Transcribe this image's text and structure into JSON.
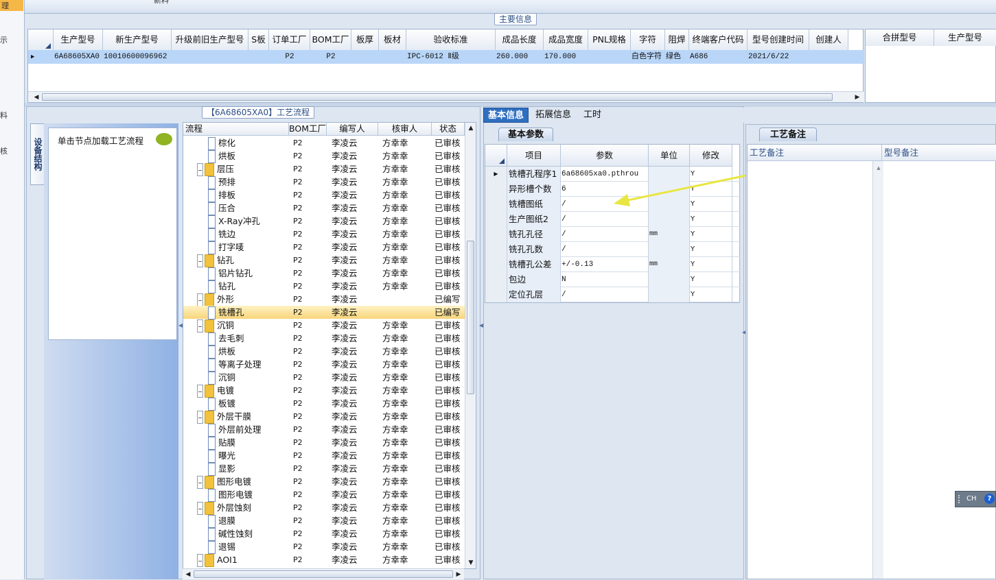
{
  "left_strip": {
    "tab": "理",
    "chars": [
      "示",
      "料",
      "核"
    ]
  },
  "top_tab": "新料",
  "main_info": {
    "title": "主要信息",
    "columns": [
      "生产型号",
      "新生产型号",
      "升级前旧生产型号",
      "S板",
      "订单工厂",
      "BOM工厂",
      "板厚",
      "板材",
      "验收标准",
      "成品长度",
      "成品宽度",
      "PNL规格",
      "字符",
      "阻焊",
      "终端客户代码",
      "型号创建时间",
      "创建人"
    ],
    "row": [
      "6A68605XA0",
      "10010600096962",
      "",
      "",
      "P2",
      "P2",
      "",
      "",
      "IPC-6012 Ⅱ级",
      "260.000",
      "170.000",
      "",
      "白色字符",
      "绿色",
      "A686",
      "2021/6/22",
      ""
    ],
    "right_columns": [
      "合拼型号",
      "生产型号"
    ]
  },
  "flow": {
    "title": "【6A68605XA0】工艺流程",
    "side_tab": "设备结构",
    "nav_text": "单击节点加载工艺流程",
    "columns": [
      "流程",
      "BOM工厂",
      "编写人",
      "核审人",
      "状态"
    ],
    "rows": [
      {
        "level": 2,
        "name": "棕化",
        "bom": "P2",
        "writer": "李凌云",
        "reviewer": "方幸幸",
        "status": "已审核"
      },
      {
        "level": 2,
        "name": "烘板",
        "bom": "P2",
        "writer": "李凌云",
        "reviewer": "方幸幸",
        "status": "已审核"
      },
      {
        "level": 1,
        "name": "层压",
        "bom": "P2",
        "writer": "李凌云",
        "reviewer": "方幸幸",
        "status": "已审核"
      },
      {
        "level": 2,
        "name": "预排",
        "bom": "P2",
        "writer": "李凌云",
        "reviewer": "方幸幸",
        "status": "已审核"
      },
      {
        "level": 2,
        "name": "排板",
        "bom": "P2",
        "writer": "李凌云",
        "reviewer": "方幸幸",
        "status": "已审核"
      },
      {
        "level": 2,
        "name": "压合",
        "bom": "P2",
        "writer": "李凌云",
        "reviewer": "方幸幸",
        "status": "已审核"
      },
      {
        "level": 2,
        "name": "X-Ray冲孔",
        "bom": "P2",
        "writer": "李凌云",
        "reviewer": "方幸幸",
        "status": "已审核"
      },
      {
        "level": 2,
        "name": "铣边",
        "bom": "P2",
        "writer": "李凌云",
        "reviewer": "方幸幸",
        "status": "已审核"
      },
      {
        "level": 2,
        "name": "打字唛",
        "bom": "P2",
        "writer": "李凌云",
        "reviewer": "方幸幸",
        "status": "已审核"
      },
      {
        "level": 1,
        "name": "钻孔",
        "bom": "P2",
        "writer": "李凌云",
        "reviewer": "方幸幸",
        "status": "已审核"
      },
      {
        "level": 2,
        "name": "铝片钻孔",
        "bom": "P2",
        "writer": "李凌云",
        "reviewer": "方幸幸",
        "status": "已审核"
      },
      {
        "level": 2,
        "name": "钻孔",
        "bom": "P2",
        "writer": "李凌云",
        "reviewer": "方幸幸",
        "status": "已审核"
      },
      {
        "level": 1,
        "name": "外形",
        "bom": "P2",
        "writer": "李凌云",
        "reviewer": "",
        "status": "已编写"
      },
      {
        "level": 2,
        "name": "铣槽孔",
        "bom": "P2",
        "writer": "李凌云",
        "reviewer": "",
        "status": "已编写",
        "selected": true
      },
      {
        "level": 1,
        "name": "沉铜",
        "bom": "P2",
        "writer": "李凌云",
        "reviewer": "方幸幸",
        "status": "已审核"
      },
      {
        "level": 2,
        "name": "去毛刺",
        "bom": "P2",
        "writer": "李凌云",
        "reviewer": "方幸幸",
        "status": "已审核"
      },
      {
        "level": 2,
        "name": "烘板",
        "bom": "P2",
        "writer": "李凌云",
        "reviewer": "方幸幸",
        "status": "已审核"
      },
      {
        "level": 2,
        "name": "等离子处理",
        "bom": "P2",
        "writer": "李凌云",
        "reviewer": "方幸幸",
        "status": "已审核"
      },
      {
        "level": 2,
        "name": "沉铜",
        "bom": "P2",
        "writer": "李凌云",
        "reviewer": "方幸幸",
        "status": "已审核"
      },
      {
        "level": 1,
        "name": "电镀",
        "bom": "P2",
        "writer": "李凌云",
        "reviewer": "方幸幸",
        "status": "已审核"
      },
      {
        "level": 2,
        "name": "板镀",
        "bom": "P2",
        "writer": "李凌云",
        "reviewer": "方幸幸",
        "status": "已审核"
      },
      {
        "level": 1,
        "name": "外层干膜",
        "bom": "P2",
        "writer": "李凌云",
        "reviewer": "方幸幸",
        "status": "已审核"
      },
      {
        "level": 2,
        "name": "外层前处理",
        "bom": "P2",
        "writer": "李凌云",
        "reviewer": "方幸幸",
        "status": "已审核"
      },
      {
        "level": 2,
        "name": "贴膜",
        "bom": "P2",
        "writer": "李凌云",
        "reviewer": "方幸幸",
        "status": "已审核"
      },
      {
        "level": 2,
        "name": "曝光",
        "bom": "P2",
        "writer": "李凌云",
        "reviewer": "方幸幸",
        "status": "已审核"
      },
      {
        "level": 2,
        "name": "显影",
        "bom": "P2",
        "writer": "李凌云",
        "reviewer": "方幸幸",
        "status": "已审核"
      },
      {
        "level": 1,
        "name": "图形电镀",
        "bom": "P2",
        "writer": "李凌云",
        "reviewer": "方幸幸",
        "status": "已审核"
      },
      {
        "level": 2,
        "name": "图形电镀",
        "bom": "P2",
        "writer": "李凌云",
        "reviewer": "方幸幸",
        "status": "已审核"
      },
      {
        "level": 1,
        "name": "外层蚀刻",
        "bom": "P2",
        "writer": "李凌云",
        "reviewer": "方幸幸",
        "status": "已审核"
      },
      {
        "level": 2,
        "name": "退膜",
        "bom": "P2",
        "writer": "李凌云",
        "reviewer": "方幸幸",
        "status": "已审核"
      },
      {
        "level": 2,
        "name": "碱性蚀刻",
        "bom": "P2",
        "writer": "李凌云",
        "reviewer": "方幸幸",
        "status": "已审核"
      },
      {
        "level": 2,
        "name": "退锡",
        "bom": "P2",
        "writer": "李凌云",
        "reviewer": "方幸幸",
        "status": "已审核"
      },
      {
        "level": 1,
        "name": "AOI1",
        "bom": "P2",
        "writer": "李凌云",
        "reviewer": "方幸幸",
        "status": "已审核"
      }
    ]
  },
  "tabs": [
    "基本信息",
    "拓展信息",
    "工时"
  ],
  "basic": {
    "subtab": "基本参数",
    "columns": [
      "项目",
      "参数",
      "单位",
      "修改"
    ],
    "rows": [
      {
        "item": "铣槽孔程序1",
        "param": "6a68605xa0.pthrou",
        "unit": "",
        "mod": "Y"
      },
      {
        "item": "异形槽个数",
        "param": "6",
        "unit": "",
        "mod": "Y"
      },
      {
        "item": "铣槽图纸",
        "param": "/",
        "unit": "",
        "mod": "Y"
      },
      {
        "item": "生产图纸2",
        "param": "/",
        "unit": "",
        "mod": "Y"
      },
      {
        "item": "铣孔孔径",
        "param": "/",
        "unit": "mm",
        "mod": "Y"
      },
      {
        "item": "铣孔孔数",
        "param": "/",
        "unit": "",
        "mod": "Y"
      },
      {
        "item": "铣槽孔公差",
        "param": "+/-0.13",
        "unit": "mm",
        "mod": "Y"
      },
      {
        "item": "包边",
        "param": "N",
        "unit": "",
        "mod": "Y"
      },
      {
        "item": "定位孔层",
        "param": "/",
        "unit": "",
        "mod": "Y"
      }
    ]
  },
  "remarks": {
    "subtab": "工艺备注",
    "columns": [
      "工艺备注",
      "型号备注"
    ]
  },
  "ime": {
    "label": "CH",
    "help": "?"
  },
  "colors": {
    "selected_row": "#b9d6f8",
    "active_tab": "#2f6fc0",
    "arrow": "#e8e640"
  }
}
